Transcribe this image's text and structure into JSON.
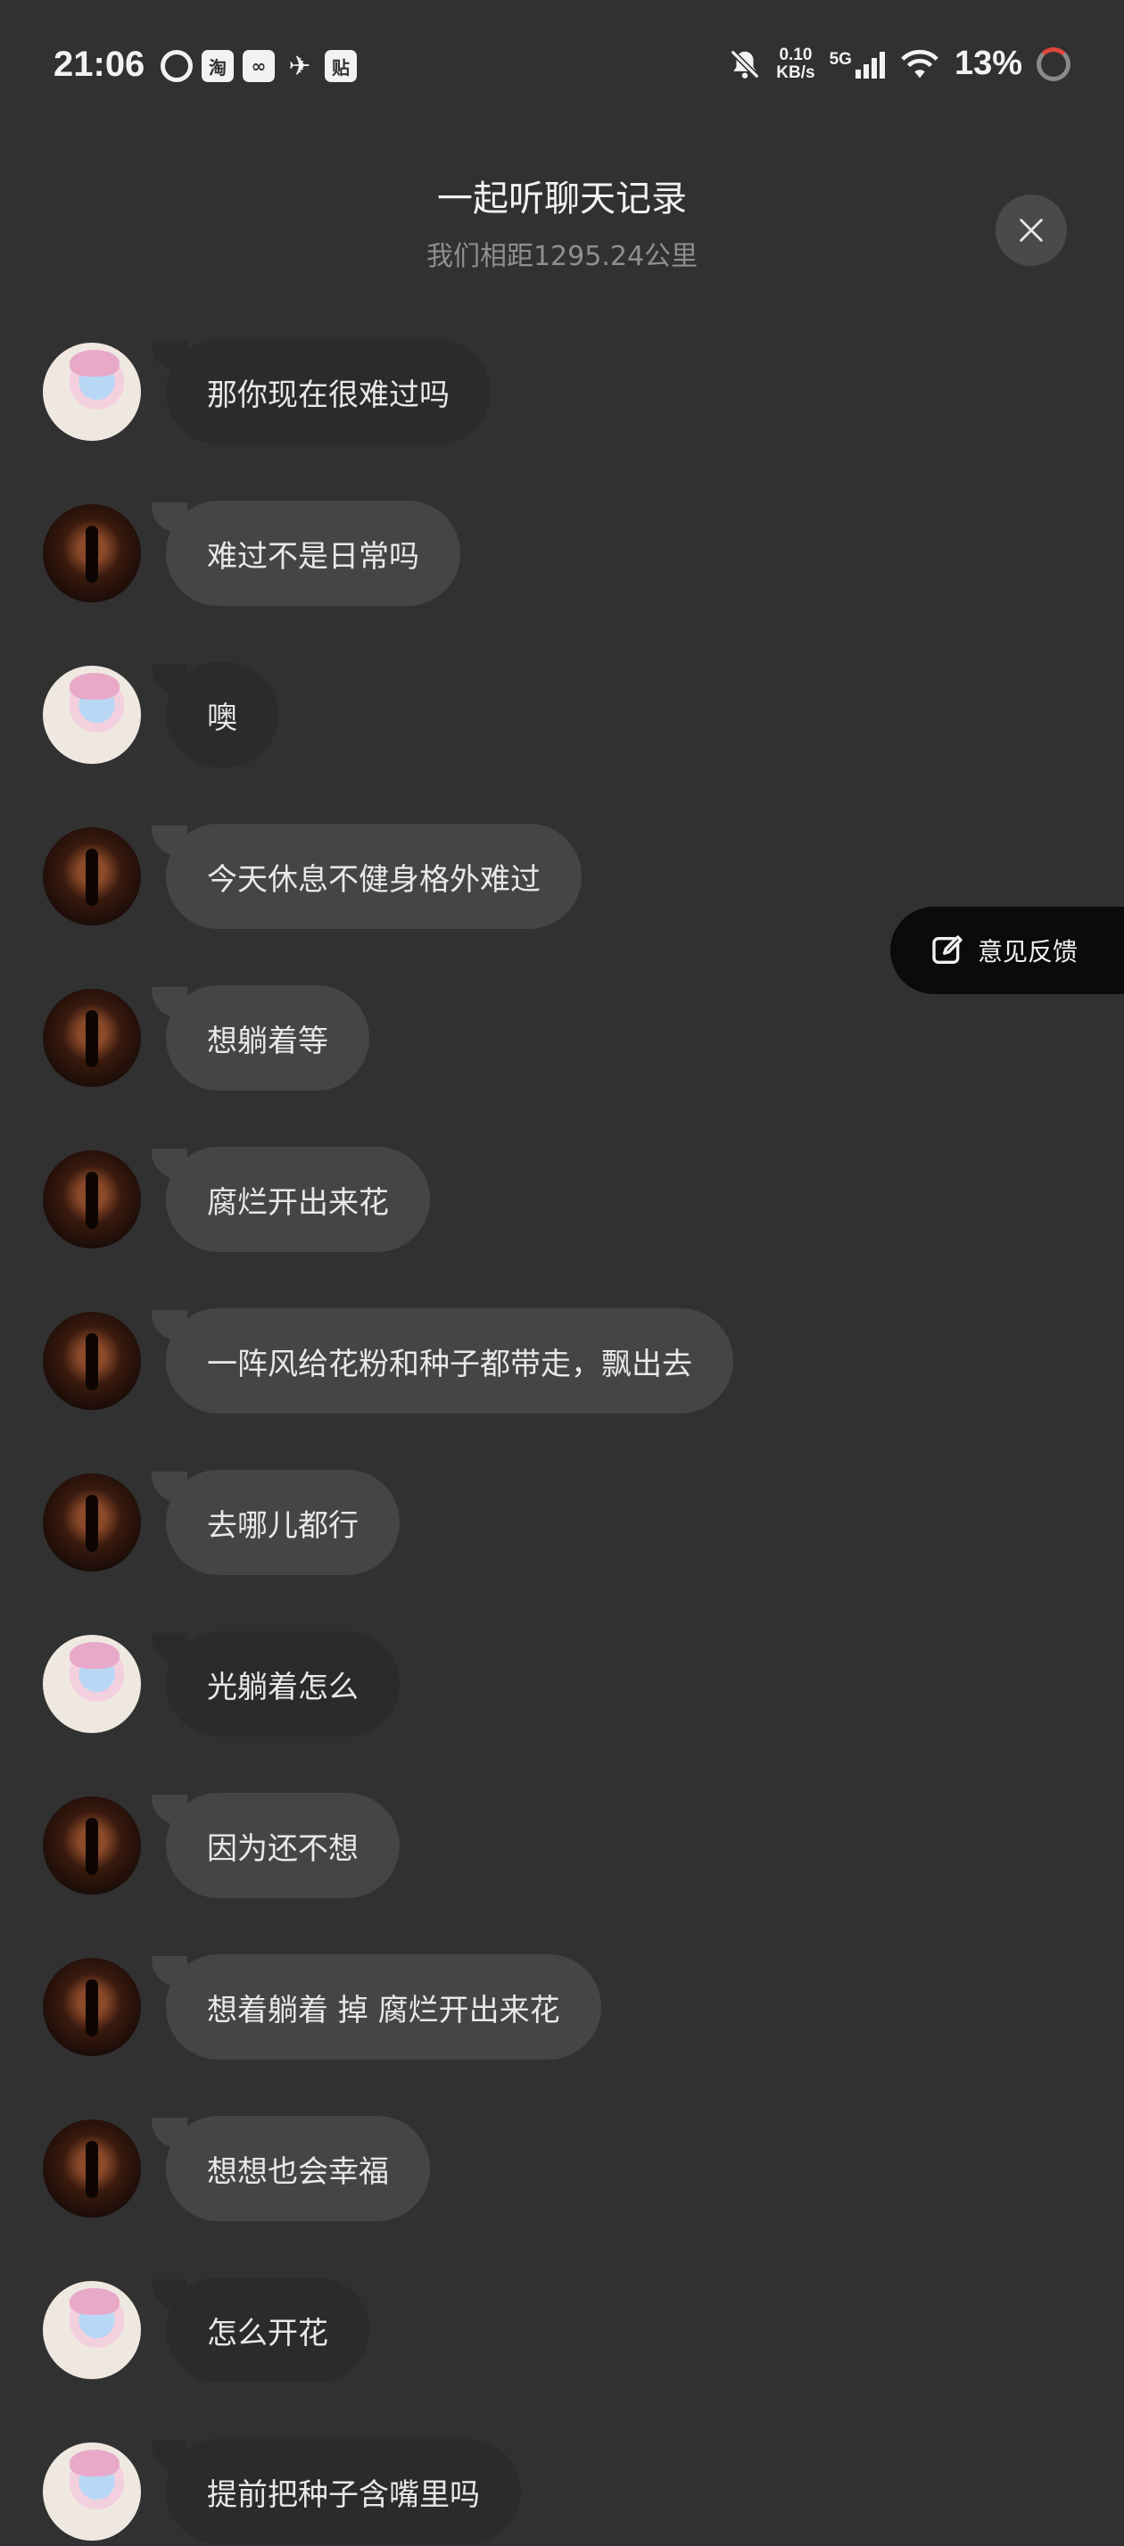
{
  "status_bar": {
    "time": "21:06",
    "app_icons": [
      "netease-icon",
      "taobao-icon",
      "app-icon",
      "bird-icon",
      "tieba-icon"
    ],
    "app_icon_labels": [
      "",
      "淘",
      "",
      "",
      "贴"
    ],
    "net_speed_value": "0.10",
    "net_speed_unit": "KB/s",
    "network": "5G",
    "battery": "13%"
  },
  "header": {
    "title": "一起听聊天记录",
    "subtitle": "我们相距1295.24公里"
  },
  "feedback": {
    "label": "意见反馈"
  },
  "colors": {
    "background": "#313131",
    "bubble_other": "#454545",
    "bubble_self": "#2b2b2b",
    "feedback_bg": "#0b0b0b"
  },
  "messages": [
    {
      "sender": "anime",
      "text": "那你现在很难过吗"
    },
    {
      "sender": "dark",
      "text": "难过不是日常吗"
    },
    {
      "sender": "anime",
      "text": "噢"
    },
    {
      "sender": "dark",
      "text": "今天休息不健身格外难过"
    },
    {
      "sender": "dark",
      "text": "想躺着等"
    },
    {
      "sender": "dark",
      "text": "腐烂开出来花"
    },
    {
      "sender": "dark",
      "text": "一阵风给花粉和种子都带走，飘出去"
    },
    {
      "sender": "dark",
      "text": "去哪儿都行"
    },
    {
      "sender": "anime",
      "text": "光躺着怎么"
    },
    {
      "sender": "dark",
      "text": "因为还不想"
    },
    {
      "sender": "dark",
      "text": "想着躺着 掉 腐烂开出来花"
    },
    {
      "sender": "dark",
      "text": "想想也会幸福"
    },
    {
      "sender": "anime",
      "text": "怎么开花"
    },
    {
      "sender": "anime",
      "text": "提前把种子含嘴里吗"
    }
  ]
}
